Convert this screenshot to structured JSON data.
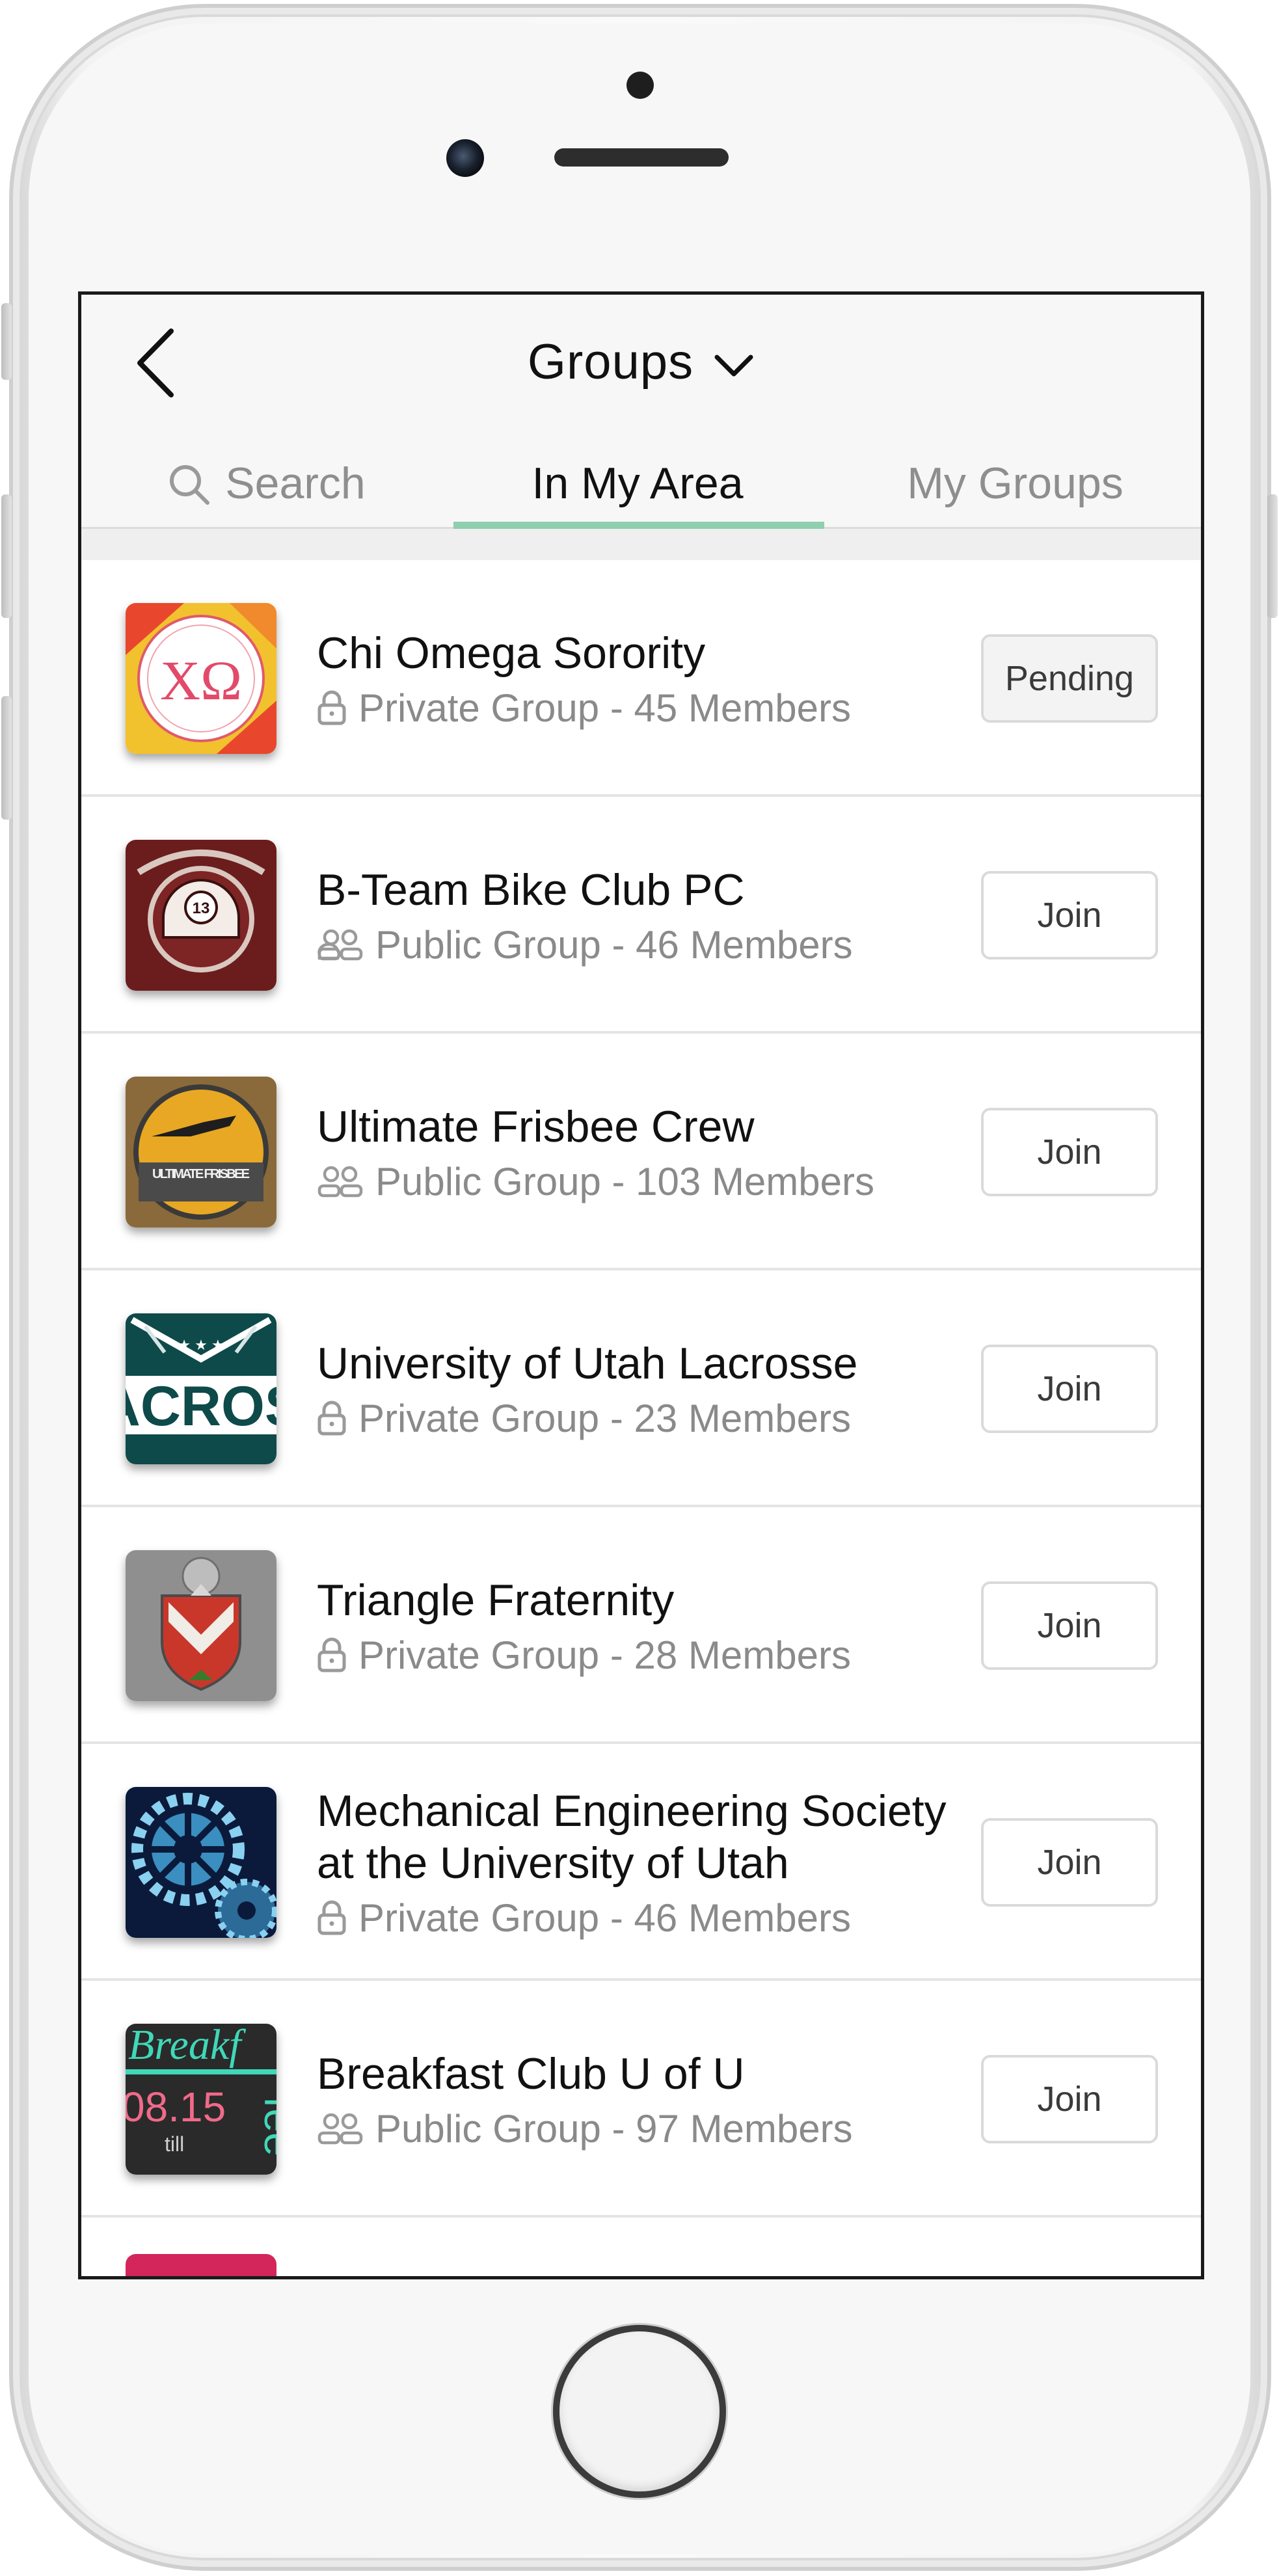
{
  "header": {
    "title": "Groups"
  },
  "tabs": {
    "search_label": "Search",
    "area_label": "In My Area",
    "mine_label": "My Groups",
    "active": "In My Area"
  },
  "groups": [
    {
      "name": "Chi Omega Sorority",
      "privacy_icon": "lock-icon",
      "meta": "Private Group - 45 Members",
      "action": "Pending",
      "logo_text": "ΧΩ"
    },
    {
      "name": "B-Team Bike Club PC",
      "privacy_icon": "people-icon",
      "meta": "Public Group - 46 Members",
      "action": "Join",
      "logo_text": "13"
    },
    {
      "name": "Ultimate Frisbee Crew",
      "privacy_icon": "people-icon",
      "meta": "Public Group - 103 Members",
      "action": "Join",
      "logo_text": "ULTIMATE FRISBEE"
    },
    {
      "name": "University of Utah Lacrosse",
      "privacy_icon": "lock-icon",
      "meta": "Private Group - 23 Members",
      "action": "Join",
      "logo_text": "ACROS"
    },
    {
      "name": "Triangle Fraternity",
      "privacy_icon": "lock-icon",
      "meta": "Private Group - 28 Members",
      "action": "Join",
      "logo_text": ""
    },
    {
      "name": "Mechanical Engineering Society at the University of Utah",
      "privacy_icon": "lock-icon",
      "meta": "Private Group - 46 Members",
      "action": "Join",
      "logo_text": ""
    },
    {
      "name": "Breakfast Club U of U",
      "privacy_icon": "people-icon",
      "meta": "Public Group - 97 Members",
      "action": "Join",
      "logo_text": "Breakf 08.15 till fee"
    }
  ],
  "colors": {
    "tab_accent": "#8fcfae",
    "peek_logo": "#d3265b"
  }
}
